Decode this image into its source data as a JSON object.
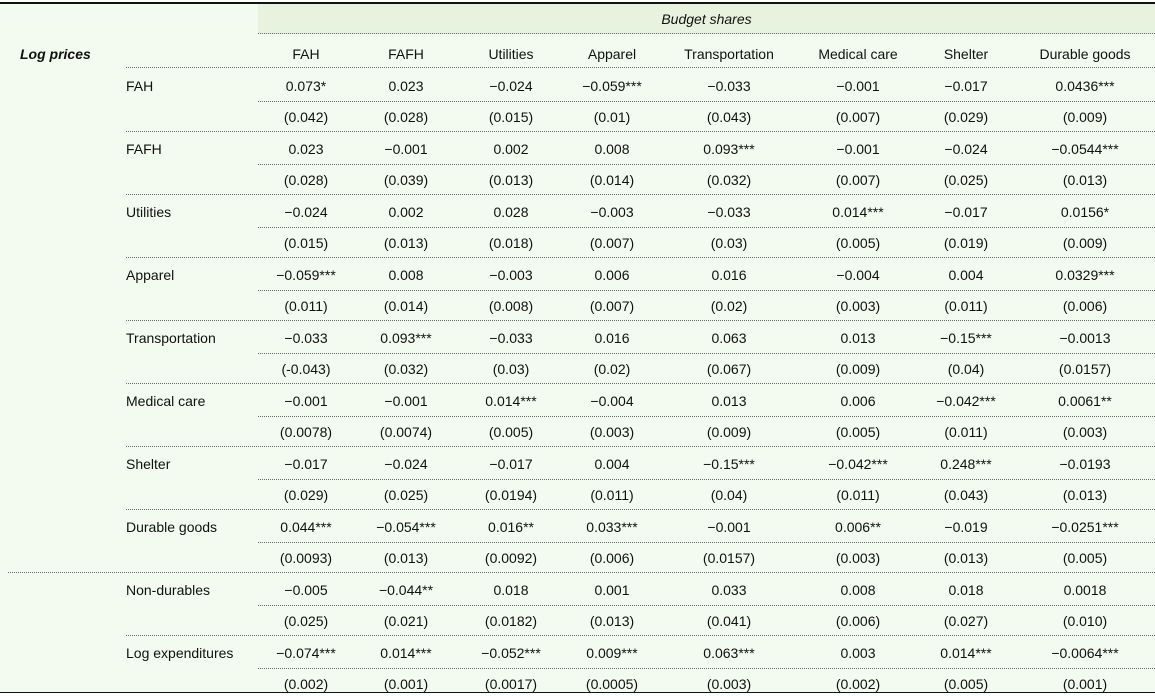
{
  "table": {
    "super_header": "Budget shares",
    "stub_header": "Log prices",
    "columns": [
      "FAH",
      "FAFH",
      "Utilities",
      "Apparel",
      "Transportation",
      "Medical care",
      "Shelter",
      "Durable goods"
    ],
    "rows": [
      {
        "label": "FAH",
        "coef": [
          "0.073*",
          "0.023",
          "−0.024",
          "−0.059***",
          "−0.033",
          "−0.001",
          "−0.017",
          "0.0436***"
        ],
        "se": [
          "(0.042)",
          "(0.028)",
          "(0.015)",
          "(0.01)",
          "(0.043)",
          "(0.007)",
          "(0.029)",
          "(0.009)"
        ]
      },
      {
        "label": "FAFH",
        "coef": [
          "0.023",
          "−0.001",
          "0.002",
          "0.008",
          "0.093***",
          "−0.001",
          "−0.024",
          "−0.0544***"
        ],
        "se": [
          "(0.028)",
          "(0.039)",
          "(0.013)",
          "(0.014)",
          "(0.032)",
          "(0.007)",
          "(0.025)",
          "(0.013)"
        ]
      },
      {
        "label": "Utilities",
        "coef": [
          "−0.024",
          "0.002",
          "0.028",
          "−0.003",
          "−0.033",
          "0.014***",
          "−0.017",
          "0.0156*"
        ],
        "se": [
          "(0.015)",
          "(0.013)",
          "(0.018)",
          "(0.007)",
          "(0.03)",
          "(0.005)",
          "(0.019)",
          "(0.009)"
        ]
      },
      {
        "label": "Apparel",
        "coef": [
          "−0.059***",
          "0.008",
          "−0.003",
          "0.006",
          "0.016",
          "−0.004",
          "0.004",
          "0.0329***"
        ],
        "se": [
          "(0.011)",
          "(0.014)",
          "(0.008)",
          "(0.007)",
          "(0.02)",
          "(0.003)",
          "(0.011)",
          "(0.006)"
        ]
      },
      {
        "label": "Transportation",
        "coef": [
          "−0.033",
          "0.093***",
          "−0.033",
          "0.016",
          "0.063",
          "0.013",
          "−0.15***",
          "−0.0013"
        ],
        "se": [
          "(-0.043)",
          "(0.032)",
          "(0.03)",
          "(0.02)",
          "(0.067)",
          "(0.009)",
          "(0.04)",
          "(0.0157)"
        ]
      },
      {
        "label": "Medical care",
        "coef": [
          "−0.001",
          "−0.001",
          "0.014***",
          "−0.004",
          "0.013",
          "0.006",
          "−0.042***",
          "0.0061**"
        ],
        "se": [
          "(0.0078)",
          "(0.0074)",
          "(0.005)",
          "(0.003)",
          "(0.009)",
          "(0.005)",
          "(0.011)",
          "(0.003)"
        ]
      },
      {
        "label": "Shelter",
        "coef": [
          "−0.017",
          "−0.024",
          "−0.017",
          "0.004",
          "−0.15***",
          "−0.042***",
          "0.248***",
          "−0.0193"
        ],
        "se": [
          "(0.029)",
          "(0.025)",
          "(0.0194)",
          "(0.011)",
          "(0.04)",
          "(0.011)",
          "(0.043)",
          "(0.013)"
        ]
      },
      {
        "label": "Durable goods",
        "coef": [
          "0.044***",
          "−0.054***",
          "0.016**",
          "0.033***",
          "−0.001",
          "0.006**",
          "−0.019",
          "−0.0251***"
        ],
        "se": [
          "(0.0093)",
          "(0.013)",
          "(0.0092)",
          "(0.006)",
          "(0.0157)",
          "(0.003)",
          "(0.013)",
          "(0.005)"
        ]
      },
      {
        "label": "Non-durables",
        "coef": [
          "−0.005",
          "−0.044**",
          "0.018",
          "0.001",
          "0.033",
          "0.008",
          "0.018",
          "0.0018"
        ],
        "se": [
          "(0.025)",
          "(0.021)",
          "(0.0182)",
          "(0.013)",
          "(0.041)",
          "(0.006)",
          "(0.027)",
          "(0.010)"
        ]
      },
      {
        "label": "Log expenditures",
        "coef": [
          "−0.074***",
          "0.014***",
          "−0.052***",
          "0.009***",
          "0.063***",
          "0.003",
          "0.014***",
          "−0.0064***"
        ],
        "se": [
          "(0.002)",
          "(0.001)",
          "(0.0017)",
          "(0.0005)",
          "(0.003)",
          "(0.002)",
          "(0.005)",
          "(0.001)"
        ]
      }
    ]
  }
}
